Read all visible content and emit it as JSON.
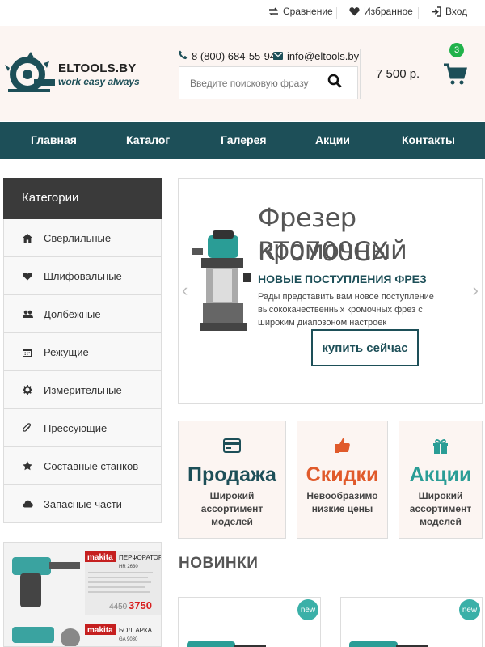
{
  "topbar": {
    "compare": "Сравнение",
    "favorites": "Избранное",
    "login": "Вход"
  },
  "header": {
    "brand": "ELTOOLS.BY",
    "tagline": "work easy always",
    "phone": "8 (800) 684-55-94",
    "email": "info@eltools.by",
    "search_placeholder": "Введите поисковую фразу",
    "cart_total": "7 500 р.",
    "cart_count": "3"
  },
  "nav": {
    "items": [
      "Главная",
      "Каталог",
      "Галерея",
      "Акции",
      "Контакты"
    ]
  },
  "sidebar": {
    "title": "Категории",
    "items": [
      {
        "label": "Сверлильные",
        "icon": "home-icon"
      },
      {
        "label": "Шлифовальные",
        "icon": "heart-icon"
      },
      {
        "label": "Долбёжные",
        "icon": "users-icon"
      },
      {
        "label": "Режущие",
        "icon": "calendar-icon"
      },
      {
        "label": "Измерительные",
        "icon": "gear-icon"
      },
      {
        "label": "Прессующие",
        "icon": "paperclip-icon"
      },
      {
        "label": "Составные станков",
        "icon": "star-icon"
      },
      {
        "label": "Запасные части",
        "icon": "cloud-icon"
      }
    ],
    "promo": {
      "brand1": "makita",
      "brand2": "makita",
      "item1_title": "ПЕРФОРАТОР",
      "item1_model": "HR 2630",
      "item1_old_price": "4450",
      "item1_price": "3750",
      "item2_title": "БОЛГАРКА",
      "item2_model": "GA 9030"
    }
  },
  "slider": {
    "title_line1": "Фрезер кромочный",
    "title_line2": "RT0700CX",
    "subtitle": "НОВЫЕ ПОСТУПЛЕНИЯ ФРЕЗ",
    "text": "Рады представить вам новое поступление высококачественных кромочных фрез с широким диапозоном настроек",
    "button": "купить сейчас"
  },
  "features": [
    {
      "title": "Продажа",
      "text": "Широкий ассортимент моделей",
      "color": "#1d4f58",
      "icon": "card-icon"
    },
    {
      "title": "Скидки",
      "text": "Невообразимо низкие цены",
      "color": "#e05a2b",
      "icon": "thumbs-up-icon"
    },
    {
      "title": "Акции",
      "text": "Широкий ассортимент моделей",
      "color": "#2a9d96",
      "icon": "gift-icon"
    }
  ],
  "new_products": {
    "title": "НОВИНКИ",
    "badge": "new"
  },
  "colors": {
    "primary": "#1d4f58",
    "accent_orange": "#e05a2b",
    "accent_teal": "#2a9d96",
    "badge_green": "#21b24b",
    "header_bg": "#fcf5f2"
  }
}
